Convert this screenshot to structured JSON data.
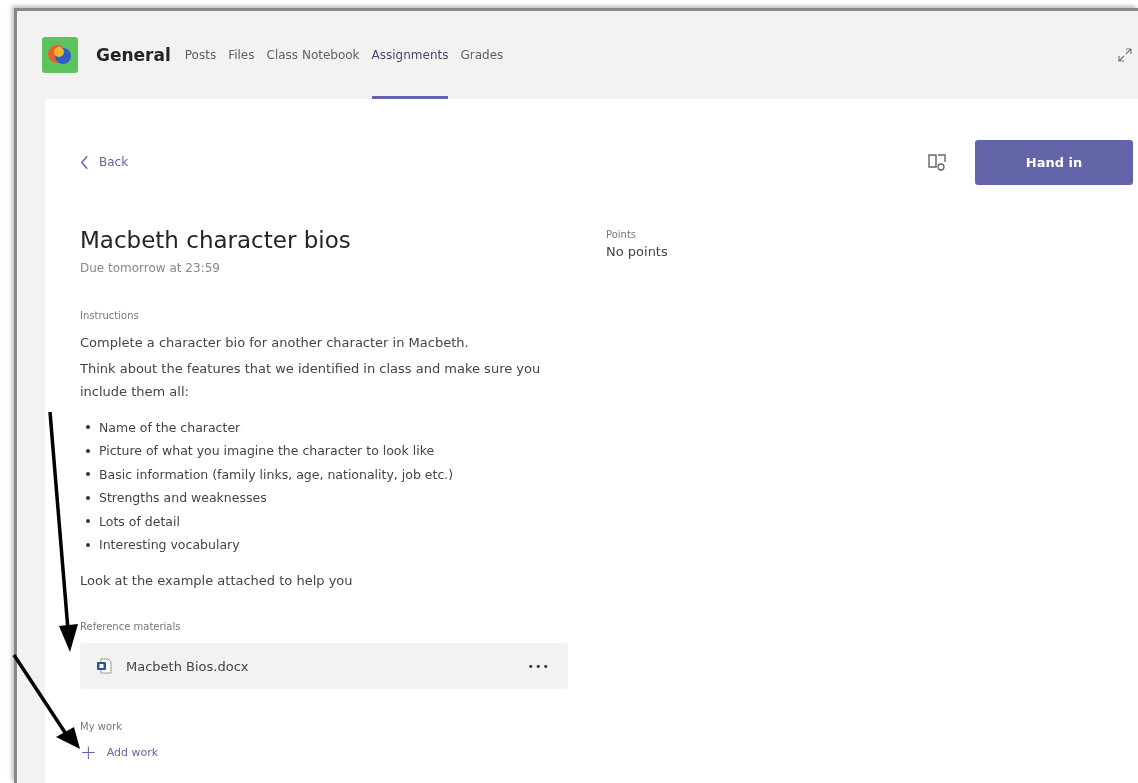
{
  "header": {
    "channel": "General",
    "tabs": [
      {
        "label": "Posts",
        "selected": false
      },
      {
        "label": "Files",
        "selected": false
      },
      {
        "label": "Class Notebook",
        "selected": false
      },
      {
        "label": "Assignments",
        "selected": true
      },
      {
        "label": "Grades",
        "selected": false
      }
    ]
  },
  "toolbar": {
    "back": "Back",
    "hand_in": "Hand in"
  },
  "assignment": {
    "title": "Macbeth character bios",
    "due": "Due tomorrow at 23:59",
    "instructions_label": "Instructions",
    "instructions": [
      "Complete a character bio for another character in Macbeth.",
      "Think about the features that we identified in class and make sure you include them all:"
    ],
    "bullets": [
      "Name of the character",
      "Picture of what you imagine the character to look like",
      "Basic information (family links, age, nationality, job etc.)",
      "Strengths and weaknesses",
      "Lots of detail",
      "Interesting vocabulary"
    ],
    "closing": "Look at the example attached to help you",
    "reference_label": "Reference materials",
    "attachment": {
      "name": "Macbeth Bios.docx",
      "more": "•••"
    },
    "my_work_label": "My work",
    "add_work": "Add work",
    "add_icon": "+"
  },
  "points": {
    "label": "Points",
    "value": "No points"
  }
}
